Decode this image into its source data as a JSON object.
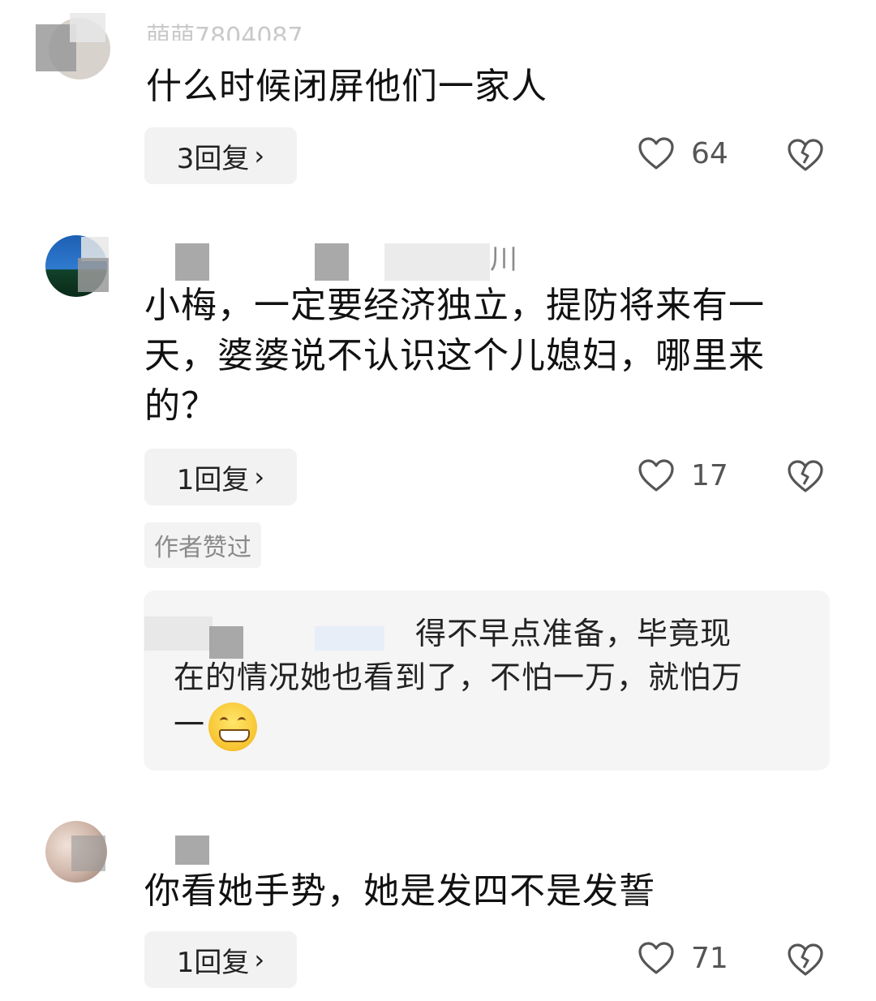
{
  "comments": [
    {
      "username": "萌萌7804087",
      "text": "什么时候闭屏他们一家人",
      "reply_label": "3回复",
      "like_count": "64"
    },
    {
      "username_tail": "川",
      "text_lines": [
        "小梅，一定要经济独立，提防将来有一",
        "天，婆婆说不认识这个儿媳妇，哪里来",
        "的？"
      ],
      "reply_label": "1回复",
      "like_count": "17",
      "badge": "作者赞过",
      "sub_reply": {
        "line1": "得不早点准备，毕竟现",
        "line2": "在的情况她也看到了，不怕一万，就怕万",
        "line3": "一"
      }
    },
    {
      "text": "你看她手势，她是发四不是发誓",
      "reply_label": "1回复",
      "like_count": "71"
    }
  ],
  "icons": {
    "like": "heart-outline-icon",
    "dislike": "broken-heart-icon",
    "chevron": "chevron-right-icon",
    "emoji": "grinning-emoji-icon"
  },
  "colors": {
    "text": "#111111",
    "muted": "#9a9a9a",
    "button_bg": "#f2f2f2"
  }
}
